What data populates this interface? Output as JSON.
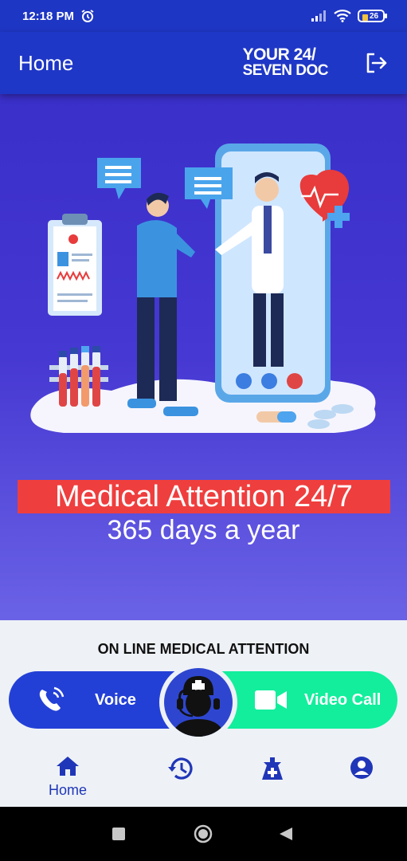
{
  "status_bar": {
    "time": "12:18 PM",
    "battery": "26"
  },
  "app_bar": {
    "title": "Home",
    "brand_line1": "YOUR 24/",
    "brand_line2": "SEVEN DOC",
    "logout_icon": "logout-icon"
  },
  "hero": {
    "headline": "Medical Attention 24/7",
    "subline": "365 days a year",
    "colors": {
      "background": "#3a2fc9",
      "headline_bg": "#ef3e3e"
    }
  },
  "panel": {
    "title": "ON LINE MEDICAL ATTENTION",
    "voice_label": "Voice",
    "video_label": "Video Call",
    "colors": {
      "voice": "#2340d6",
      "video": "#12ee9c"
    }
  },
  "bottom_nav": {
    "items": [
      {
        "icon": "home-icon",
        "label": "Home",
        "active": true
      },
      {
        "icon": "history-icon",
        "label": ""
      },
      {
        "icon": "medical-kit-icon",
        "label": ""
      },
      {
        "icon": "profile-icon",
        "label": ""
      }
    ]
  }
}
